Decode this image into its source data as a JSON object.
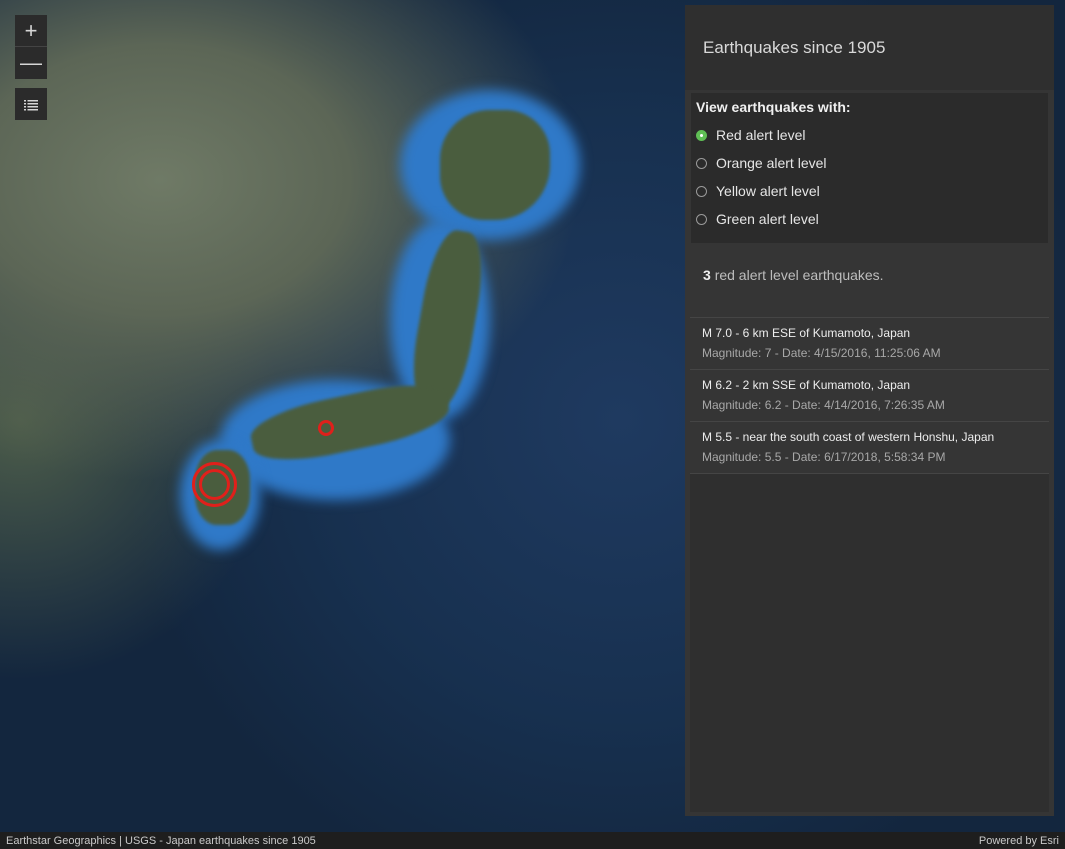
{
  "map": {
    "zoom_in_label": "+",
    "zoom_out_label": "—",
    "layer_list_icon": "list-icon"
  },
  "panel": {
    "title": "Earthquakes since 1905",
    "filter_title": "View earthquakes with:",
    "filters": [
      {
        "label": "Red alert level",
        "checked": true
      },
      {
        "label": "Orange alert level",
        "checked": false
      },
      {
        "label": "Yellow alert level",
        "checked": false
      },
      {
        "label": "Green alert level",
        "checked": false
      }
    ],
    "summary_count": "3",
    "summary_text": "red alert level earthquakes.",
    "results": [
      {
        "title": "M 7.0 - 6 km ESE of Kumamoto, Japan",
        "meta": "Magnitude: 7 - Date: 4/15/2016, 11:25:06 AM"
      },
      {
        "title": "M 6.2 - 2 km SSE of Kumamoto, Japan",
        "meta": "Magnitude: 6.2 - Date: 4/14/2016, 7:26:35 AM"
      },
      {
        "title": "M 5.5 - near the south coast of western Honshu, Japan",
        "meta": "Magnitude: 5.5 - Date: 6/17/2018, 5:58:34 PM"
      }
    ]
  },
  "attribution": {
    "left": "Earthstar Geographics | USGS - Japan earthquakes since 1905",
    "right": "Powered by Esri"
  },
  "colors": {
    "alert_red": "#e0201b",
    "radio_checked": "#5fbf55"
  }
}
